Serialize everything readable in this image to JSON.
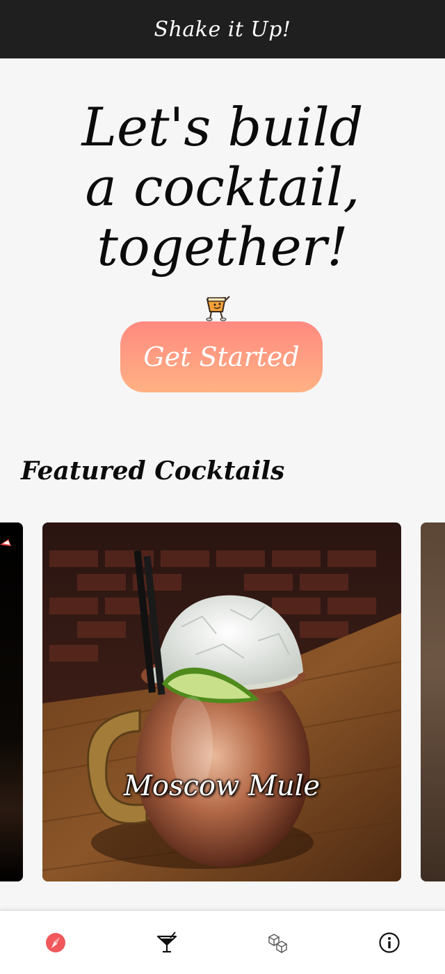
{
  "header": {
    "title": "Shake it Up!"
  },
  "hero": {
    "lines": [
      "Let's build",
      "a cocktail,",
      "together!"
    ],
    "cta_label": "Get Started"
  },
  "featured": {
    "title": "Featured Cocktails",
    "cards": [
      {
        "label": ""
      },
      {
        "label": "Moscow Mule"
      },
      {
        "label": ""
      }
    ]
  },
  "nav": {
    "items": [
      {
        "icon": "compass-icon",
        "active": true
      },
      {
        "icon": "cocktail-glass-icon",
        "active": false
      },
      {
        "icon": "ice-cubes-icon",
        "active": false
      },
      {
        "icon": "info-icon",
        "active": false
      }
    ]
  },
  "colors": {
    "topbar": "#1f1f1f",
    "cta_gradient_top": "#ff8a80",
    "cta_gradient_bottom": "#ffb183",
    "nav_active": "#f0585b"
  }
}
